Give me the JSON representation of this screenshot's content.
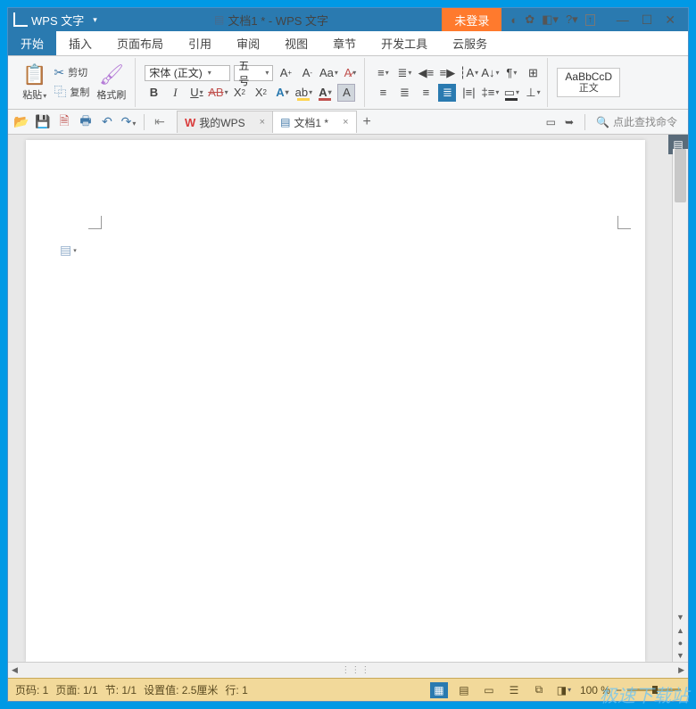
{
  "app": {
    "name": "WPS 文字",
    "doc_title": "文档1 * - WPS 文字",
    "login": "未登录"
  },
  "tabs": [
    {
      "label": "开始",
      "active": true
    },
    {
      "label": "插入"
    },
    {
      "label": "页面布局"
    },
    {
      "label": "引用"
    },
    {
      "label": "审阅"
    },
    {
      "label": "视图"
    },
    {
      "label": "章节"
    },
    {
      "label": "开发工具"
    },
    {
      "label": "云服务"
    }
  ],
  "clipboard": {
    "cut": "剪切",
    "copy": "复制",
    "paste": "粘贴",
    "format_painter": "格式刷"
  },
  "font": {
    "name": "宋体 (正文)",
    "size": "五号"
  },
  "style": {
    "sample": "AaBbCcD",
    "name": "正文"
  },
  "doc_tabs": {
    "home": "我的WPS",
    "doc1": "文档1 *"
  },
  "search": {
    "placeholder": "点此查找命令"
  },
  "status": {
    "page_no": "页码: 1",
    "page": "页面: 1/1",
    "section": "节: 1/1",
    "position": "设置值: 2.5厘米",
    "line": "行: 1",
    "zoom": "100 %"
  },
  "watermark": "极速下载站"
}
